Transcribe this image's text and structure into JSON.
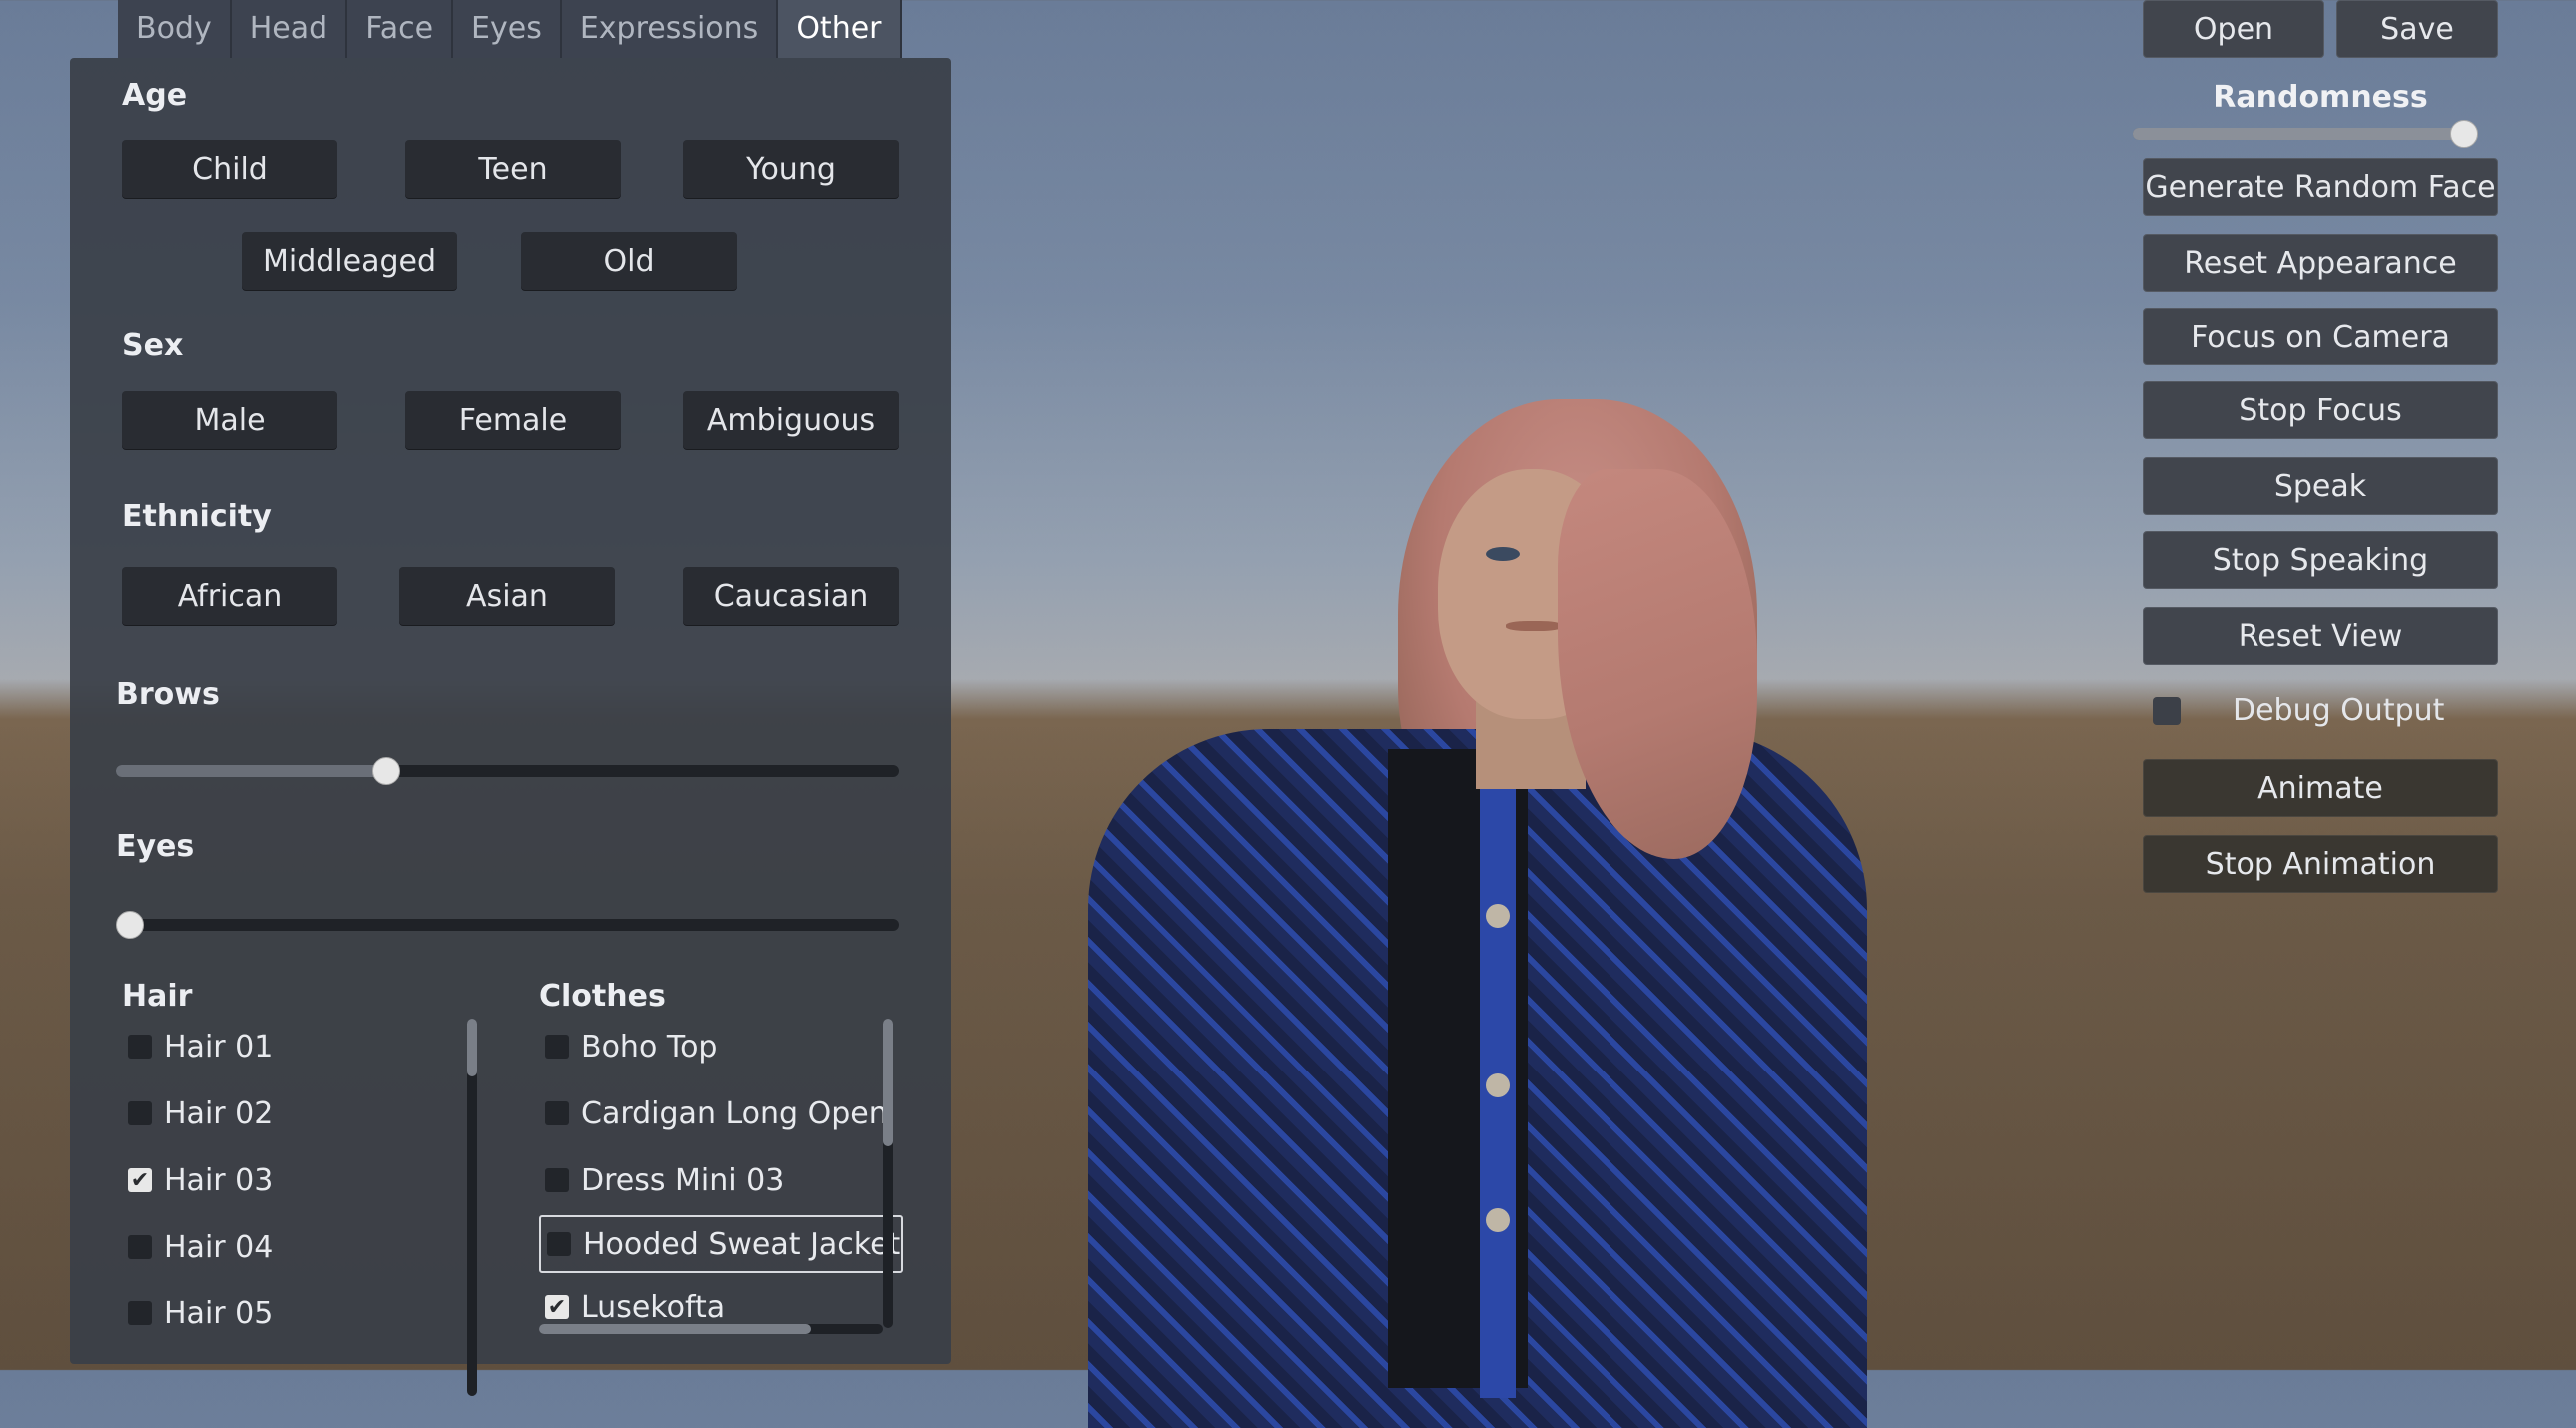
{
  "tabs": [
    "Body",
    "Head",
    "Face",
    "Eyes",
    "Expressions",
    "Other"
  ],
  "active_tab": "Other",
  "age": {
    "label": "Age",
    "buttons": [
      "Child",
      "Teen",
      "Young",
      "Middleaged",
      "Old"
    ]
  },
  "sex": {
    "label": "Sex",
    "buttons": [
      "Male",
      "Female",
      "Ambiguous"
    ]
  },
  "ethnicity": {
    "label": "Ethnicity",
    "buttons": [
      "African",
      "Asian",
      "Caucasian"
    ]
  },
  "brows": {
    "label": "Brows",
    "value": 0.34
  },
  "eyes": {
    "label": "Eyes",
    "value": 0.0
  },
  "hair": {
    "label": "Hair",
    "items": [
      {
        "label": "Hair 01",
        "checked": false
      },
      {
        "label": "Hair 02",
        "checked": false
      },
      {
        "label": "Hair 03",
        "checked": true
      },
      {
        "label": "Hair 04",
        "checked": false
      },
      {
        "label": "Hair 05",
        "checked": false
      }
    ]
  },
  "clothes": {
    "label": "Clothes",
    "items": [
      {
        "label": "Boho Top",
        "checked": false
      },
      {
        "label": "Cardigan Long Open",
        "checked": false
      },
      {
        "label": "Dress Mini 03",
        "checked": false
      },
      {
        "label": "Hooded Sweat Jacket",
        "checked": false
      },
      {
        "label": "Lusekofta",
        "checked": true
      }
    ]
  },
  "right": {
    "open": "Open",
    "save": "Save",
    "randomness_label": "Randomness",
    "randomness_value": 1.0,
    "buttons": [
      "Generate Random Face",
      "Reset Appearance",
      "Focus on Camera",
      "Stop Focus",
      "Speak",
      "Stop Speaking",
      "Reset View"
    ],
    "debug_output": "Debug Output",
    "debug_checked": false,
    "animate": "Animate",
    "stop_animation": "Stop Animation"
  },
  "check_glyph": "✔",
  "colors": {
    "panel": "#3a3f48",
    "button": "#292c32",
    "sky": "#6a7c98",
    "ground": "#6b5a47"
  }
}
